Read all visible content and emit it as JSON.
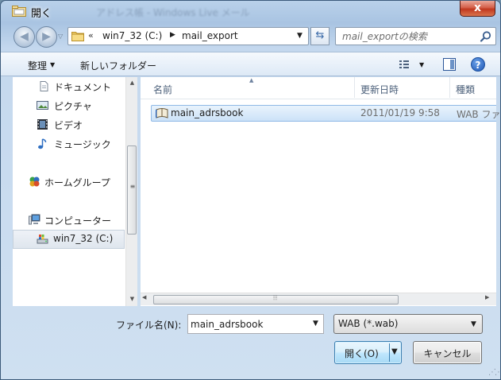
{
  "window": {
    "title": "開く",
    "ghost_title": "アドレス帳 - Windows Live メール",
    "close_label": "x"
  },
  "address_bar": {
    "overflow": "«",
    "segments": [
      "win7_32 (C:)",
      "mail_export"
    ]
  },
  "search": {
    "placeholder": "mail_exportの検索"
  },
  "toolbar": {
    "organize_label": "整理",
    "new_folder_label": "新しいフォルダー",
    "help_label": "?"
  },
  "nav": {
    "items": [
      {
        "label": "ドキュメント",
        "icon": "document-icon"
      },
      {
        "label": "ピクチャ",
        "icon": "picture-icon"
      },
      {
        "label": "ビデオ",
        "icon": "video-icon"
      },
      {
        "label": "ミュージック",
        "icon": "music-icon"
      },
      {
        "label": "ホームグループ",
        "icon": "homegroup-icon"
      },
      {
        "label": "コンピューター",
        "icon": "computer-icon"
      },
      {
        "label": "win7_32 (C:)",
        "icon": "drive-icon",
        "selected": true
      }
    ]
  },
  "filelist": {
    "columns": [
      "名前",
      "更新日時",
      "種類"
    ],
    "rows": [
      {
        "name": "main_adrsbook",
        "date": "2011/01/19 9:58",
        "type": "WAB ファ"
      }
    ]
  },
  "bottom": {
    "filename_label": "ファイル名(N):",
    "filename_value": "main_adrsbook",
    "filetype_value": "WAB (*.wab)",
    "open_label": "開く(O)",
    "cancel_label": "キャンセル"
  },
  "colors": {
    "accent": "#3c7fb1",
    "selection": "#cce2f8",
    "close": "#c0381f"
  }
}
